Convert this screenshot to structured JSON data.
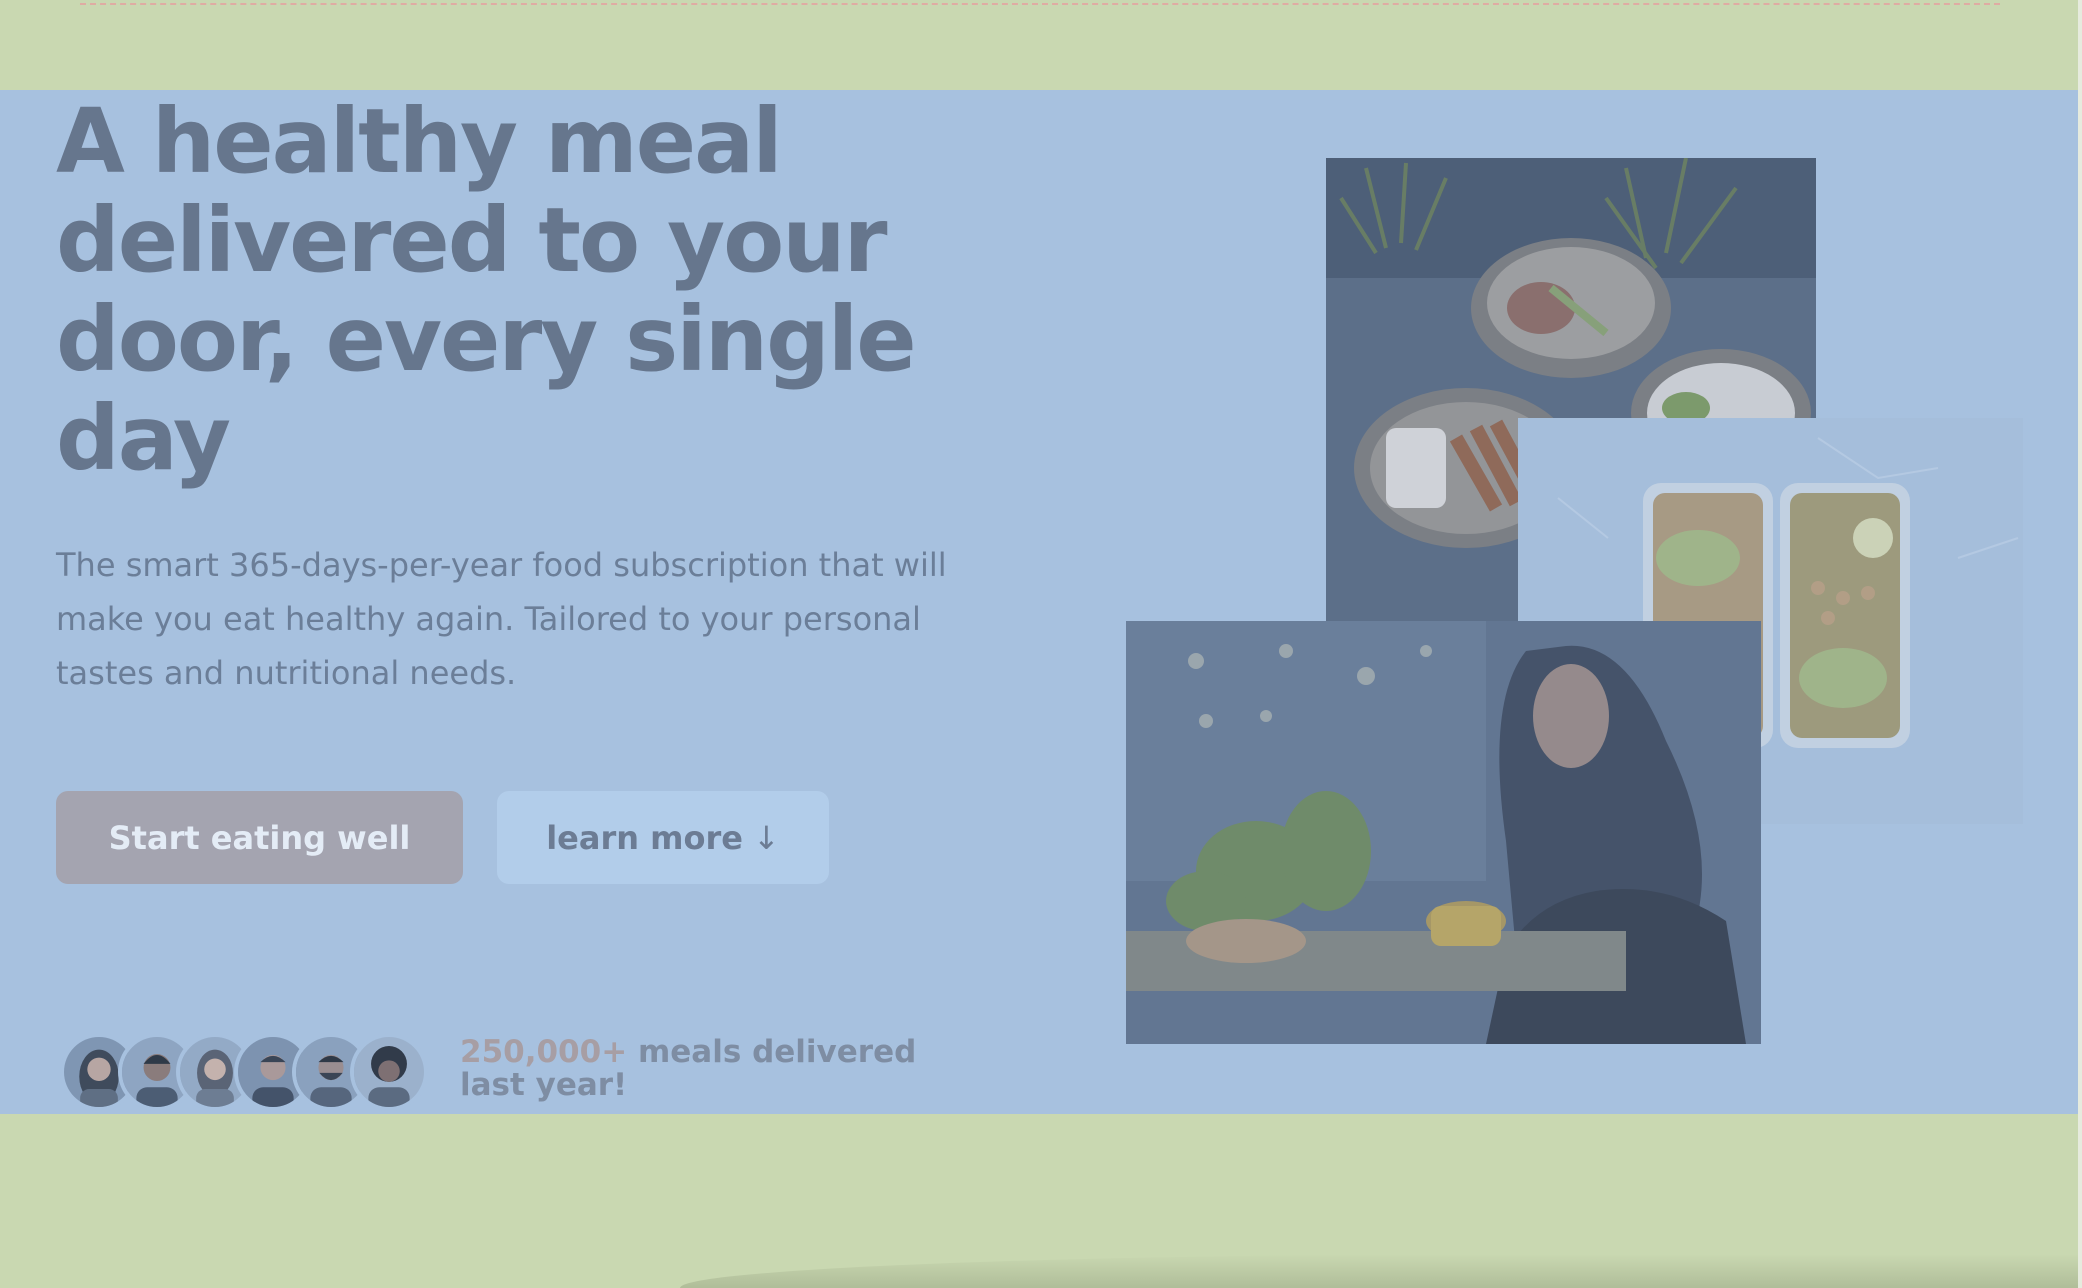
{
  "hero": {
    "title": "A healthy meal delivered to your door, every single day",
    "description": "The smart 365-days-per-year food subscription that will make you eat healthy again. Tailored to your personal tastes and nutritional needs.",
    "primary_cta": "Start eating well",
    "secondary_cta": "learn more",
    "secondary_cta_icon": "↓",
    "delivered_count": "250,000+",
    "delivered_text": "meals delivered last year!"
  },
  "avatars": [
    "customer-1",
    "customer-2",
    "customer-3",
    "customer-4",
    "customer-5",
    "customer-6"
  ],
  "photos": [
    "bowls-photo",
    "meal-prep-boxes-photo",
    "woman-eating-photo"
  ],
  "colors": {
    "hero_background": "#a7c1df",
    "outer_background": "#c9d8b1",
    "headline": "#66768d",
    "primary_button": "#a4a4b0",
    "secondary_button": "#b2cdea",
    "count_accent": "#a79ea4"
  }
}
